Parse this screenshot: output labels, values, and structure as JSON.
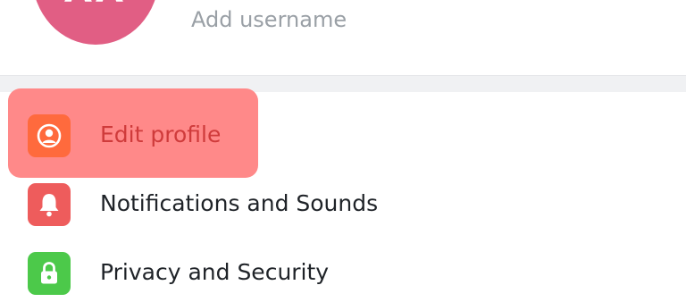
{
  "profile": {
    "avatar_initials": "AA",
    "username_placeholder": "Add username"
  },
  "menu": {
    "items": [
      {
        "label": "Edit profile",
        "icon": "person-icon",
        "color": "#ff6a3d",
        "highlighted": true
      },
      {
        "label": "Notifications and Sounds",
        "icon": "bell-icon",
        "color": "#ee5c5c"
      },
      {
        "label": "Privacy and Security",
        "icon": "lock-icon",
        "color": "#4cc94a"
      }
    ]
  },
  "colors": {
    "avatar": "#e15e84",
    "highlight": "#ff8484"
  }
}
